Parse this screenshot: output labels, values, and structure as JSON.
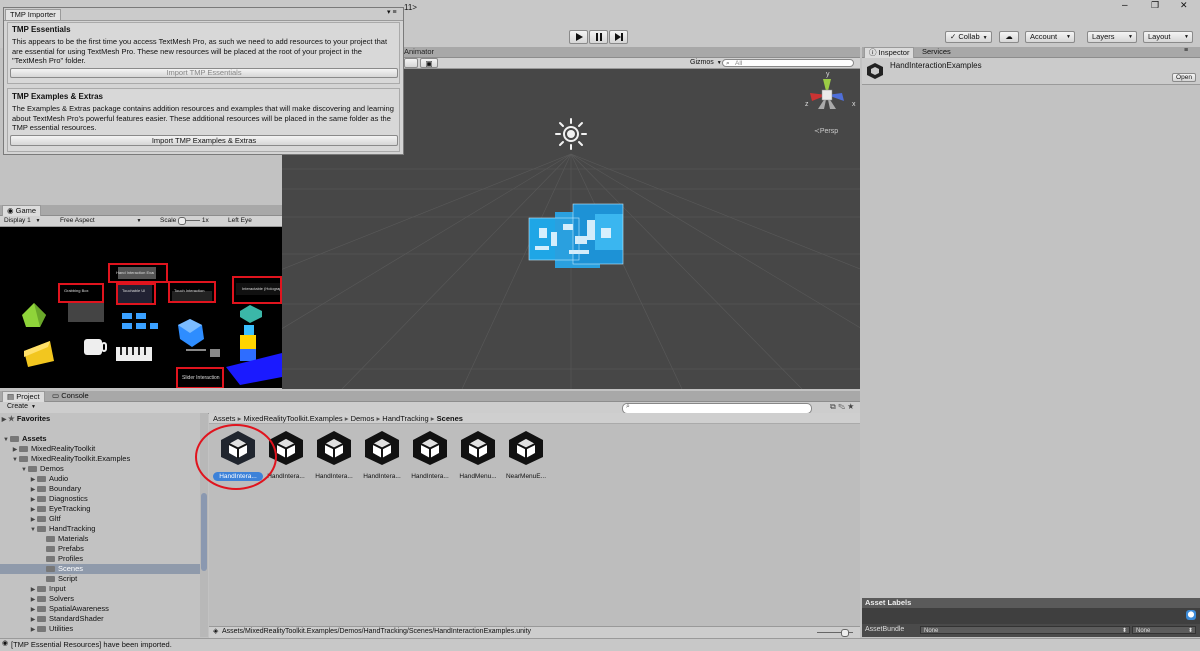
{
  "window": {
    "title_fragment": "11>",
    "controls": {
      "minimize": "–",
      "maximize": "❐",
      "close": "✕"
    }
  },
  "toolbar": {
    "collab_label": "Collab",
    "account_label": "Account",
    "layers_label": "Layers",
    "layout_label": "Layout"
  },
  "tmp_importer": {
    "title": "TMP Importer",
    "essentials": {
      "heading": "TMP Essentials",
      "body": "This appears to be the first time you access TextMesh Pro, as such we need to add resources to your project that are essential for using TextMesh Pro. These new resources will be placed at the root of your project in the \"TextMesh Pro\" folder.",
      "button": "Import TMP Essentials"
    },
    "extras": {
      "heading": "TMP Examples & Extras",
      "body": "The Examples & Extras package contains addition resources and examples that will make discovering and learning about TextMesh Pro's powerful features easier. These additional resources will be placed in the same folder as the TMP essential resources.",
      "button": "Import TMP Examples & Extras"
    }
  },
  "scene_view": {
    "animator_tab": "Animator",
    "gizmos_label": "Gizmos",
    "search_placeholder": "All",
    "persp_label": "Persp",
    "axis": {
      "y": "y",
      "x": "x",
      "z": "z"
    }
  },
  "game_view": {
    "tab": "Game",
    "display": "Display 1",
    "aspect": "Free Aspect",
    "scale_label": "Scale",
    "scale_value": "1x",
    "left_eye": "Left Eye",
    "labels": {
      "l1": "Grabbing Box",
      "l2": "Hand Interaction Examples",
      "l3": "Touchable UI",
      "l4": "Touch Interaction",
      "l5": "Interactable (Holographic Button)",
      "l6": "Slider Interaction"
    }
  },
  "project": {
    "tab": "Project",
    "console_tab": "Console",
    "create_label": "Create",
    "favorites": "Favorites",
    "tree": [
      {
        "label": "Assets",
        "depth": 0,
        "arrow": "▼",
        "bold": true,
        "selected": false
      },
      {
        "label": "MixedRealityToolkit",
        "depth": 1,
        "arrow": "▶",
        "bold": false,
        "selected": false
      },
      {
        "label": "MixedRealityToolkit.Examples",
        "depth": 1,
        "arrow": "▼",
        "bold": false,
        "selected": false
      },
      {
        "label": "Demos",
        "depth": 2,
        "arrow": "▼",
        "bold": false,
        "selected": false
      },
      {
        "label": "Audio",
        "depth": 3,
        "arrow": "▶",
        "bold": false,
        "selected": false
      },
      {
        "label": "Boundary",
        "depth": 3,
        "arrow": "▶",
        "bold": false,
        "selected": false
      },
      {
        "label": "Diagnostics",
        "depth": 3,
        "arrow": "▶",
        "bold": false,
        "selected": false
      },
      {
        "label": "EyeTracking",
        "depth": 3,
        "arrow": "▶",
        "bold": false,
        "selected": false
      },
      {
        "label": "Gltf",
        "depth": 3,
        "arrow": "▶",
        "bold": false,
        "selected": false
      },
      {
        "label": "HandTracking",
        "depth": 3,
        "arrow": "▼",
        "bold": false,
        "selected": false
      },
      {
        "label": "Materials",
        "depth": 4,
        "arrow": "",
        "bold": false,
        "selected": false
      },
      {
        "label": "Prefabs",
        "depth": 4,
        "arrow": "",
        "bold": false,
        "selected": false
      },
      {
        "label": "Profiles",
        "depth": 4,
        "arrow": "",
        "bold": false,
        "selected": false
      },
      {
        "label": "Scenes",
        "depth": 4,
        "arrow": "",
        "bold": false,
        "selected": true
      },
      {
        "label": "Script",
        "depth": 4,
        "arrow": "",
        "bold": false,
        "selected": false
      },
      {
        "label": "Input",
        "depth": 3,
        "arrow": "▶",
        "bold": false,
        "selected": false
      },
      {
        "label": "Solvers",
        "depth": 3,
        "arrow": "▶",
        "bold": false,
        "selected": false
      },
      {
        "label": "SpatialAwareness",
        "depth": 3,
        "arrow": "▶",
        "bold": false,
        "selected": false
      },
      {
        "label": "StandardShader",
        "depth": 3,
        "arrow": "▶",
        "bold": false,
        "selected": false
      },
      {
        "label": "Utilities",
        "depth": 3,
        "arrow": "▶",
        "bold": false,
        "selected": false
      }
    ],
    "breadcrumb": [
      "Assets",
      "MixedRealityToolkit.Examples",
      "Demos",
      "HandTracking",
      "Scenes"
    ],
    "assets": [
      {
        "label": "HandIntera...",
        "selected": true
      },
      {
        "label": "HandIntera...",
        "selected": false
      },
      {
        "label": "HandIntera...",
        "selected": false
      },
      {
        "label": "HandIntera...",
        "selected": false
      },
      {
        "label": "HandIntera...",
        "selected": false
      },
      {
        "label": "HandMenu...",
        "selected": false
      },
      {
        "label": "NearMenuE...",
        "selected": false
      }
    ],
    "path": "Assets/MixedRealityToolkit.Examples/Demos/HandTracking/Scenes/HandInteractionExamples.unity"
  },
  "inspector": {
    "tab": "Inspector",
    "services_tab": "Services",
    "object_name": "HandInteractionExamples",
    "open_button": "Open",
    "asset_labels": "Asset Labels",
    "asset_bundle_label": "AssetBundle",
    "bundle_none": "None",
    "variant_none": "None"
  },
  "status": {
    "message": "[TMP Essential Resources] have been imported."
  }
}
